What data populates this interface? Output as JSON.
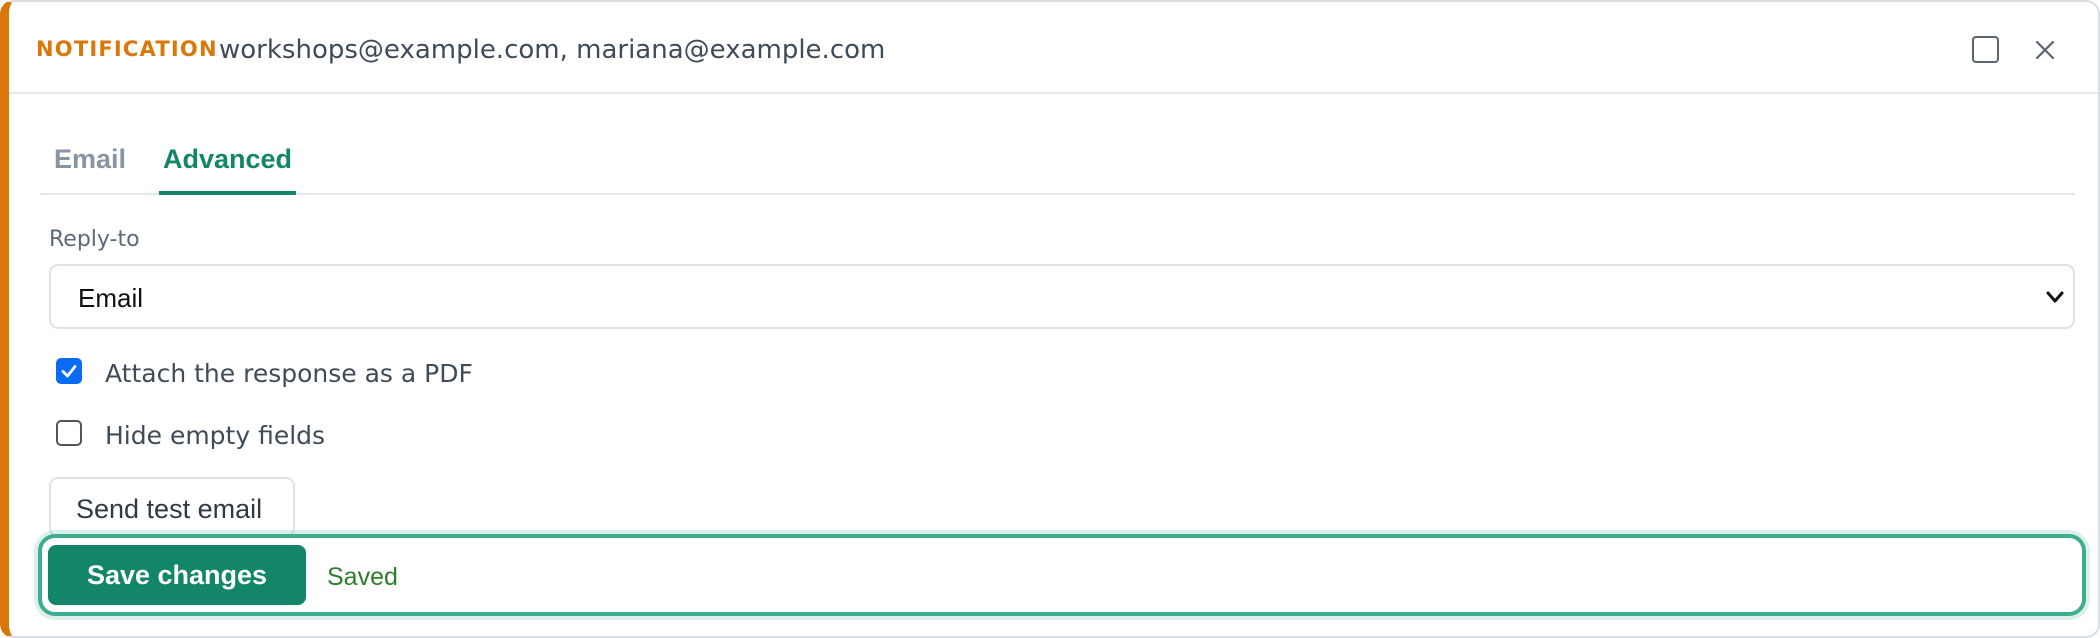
{
  "header": {
    "kind_label": "NOTIFICATION",
    "recipients": "workshops@example.com, mariana@example.com",
    "expand_icon": "square-icon",
    "close_icon": "close-icon"
  },
  "tabs": [
    {
      "label": "Email",
      "active": false
    },
    {
      "label": "Advanced",
      "active": true
    }
  ],
  "reply_to": {
    "label": "Reply-to",
    "selected": "Email",
    "icon": "chevron-down-icon"
  },
  "options": {
    "attach_pdf": {
      "label": "Attach the response as a PDF",
      "checked": true
    },
    "hide_empty": {
      "label": "Hide empty fields",
      "checked": false
    }
  },
  "actions": {
    "send_test_label": "Send test email",
    "save_label": "Save changes",
    "save_status": "Saved"
  },
  "colors": {
    "accent_orange": "#d9770b",
    "primary_green": "#138569",
    "focus_ring": "#3cae8f",
    "checkbox_blue": "#0a6cf2",
    "status_green": "#2d7d2b"
  }
}
